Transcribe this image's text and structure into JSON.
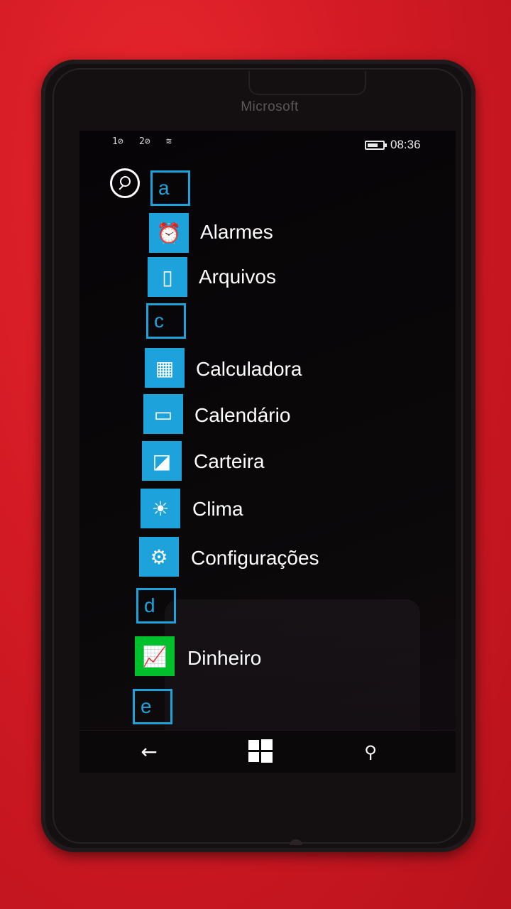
{
  "device": {
    "brand": "Microsoft"
  },
  "status": {
    "sim1": "1⊘",
    "sim2": "2⊘",
    "time": "08:36"
  },
  "apps": [
    {
      "type": "letter",
      "text": "a"
    },
    {
      "type": "app",
      "label": "Alarmes",
      "icon": "alarm-clock-icon"
    },
    {
      "type": "app",
      "label": "Arquivos",
      "icon": "file-icon"
    },
    {
      "type": "letter",
      "text": "c"
    },
    {
      "type": "app",
      "label": "Calculadora",
      "icon": "calculator-icon"
    },
    {
      "type": "app",
      "label": "Calendário",
      "icon": "calendar-icon"
    },
    {
      "type": "app",
      "label": "Carteira",
      "icon": "wallet-icon"
    },
    {
      "type": "app",
      "label": "Clima",
      "icon": "sun-icon"
    },
    {
      "type": "app",
      "label": "Configurações",
      "icon": "gear-icon"
    },
    {
      "type": "letter",
      "text": "d"
    },
    {
      "type": "app",
      "label": "Dinheiro",
      "icon": "chart-icon",
      "color": "#00c12b"
    },
    {
      "type": "letter",
      "text": "e"
    }
  ],
  "colors": {
    "accent": "#1ea2dc",
    "money": "#00c12b"
  }
}
